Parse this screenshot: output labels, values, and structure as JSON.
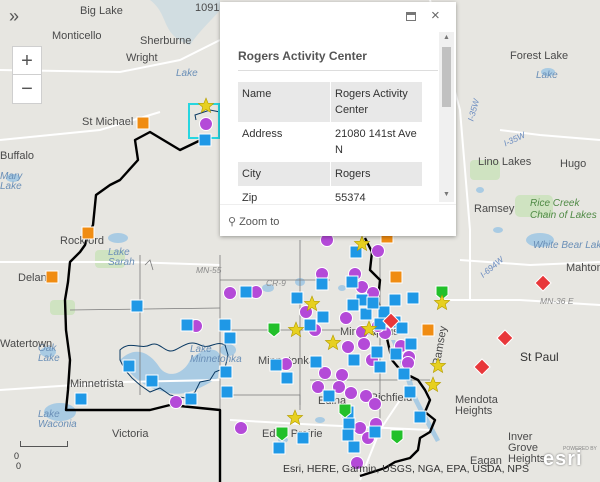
{
  "map": {
    "colors": {
      "background": "#e7e6e1",
      "water": "#a9cbe3",
      "park": "#cfe3c1",
      "boundary": "#000000",
      "blue_marker": "#1f98e6",
      "purple_marker": "#b44ad8",
      "orange_marker": "#f08c12",
      "red_marker": "#e8373a",
      "green_marker": "#22c02a",
      "yellow_marker": "#e7d020"
    },
    "place_labels": [
      {
        "text": "Big Lake",
        "style": "lg"
      },
      {
        "text": "Monticello",
        "style": "lg"
      },
      {
        "text": "Sherburne",
        "style": "lg"
      },
      {
        "text": "Wright",
        "style": "lg"
      },
      {
        "text": "St Michael",
        "style": "lg"
      },
      {
        "text": "Buffalo",
        "style": "lg"
      },
      {
        "text": "Mary Lake",
        "style": "water"
      },
      {
        "text": "Rockford",
        "style": "lg"
      },
      {
        "text": "Delano",
        "style": "lg"
      },
      {
        "text": "Lake Sarah",
        "style": "water"
      },
      {
        "text": "Oak Lake",
        "style": "water"
      },
      {
        "text": "Watertown",
        "style": "lg"
      },
      {
        "text": "Minnetrista",
        "style": "lg"
      },
      {
        "text": "Lake Waconia",
        "style": "water"
      },
      {
        "text": "Victoria",
        "style": "lg"
      },
      {
        "text": "Lake Minnetonka",
        "style": "water"
      },
      {
        "text": "Minnetonka",
        "style": "lg"
      },
      {
        "text": "Edina",
        "style": "lg"
      },
      {
        "text": "Eden Prairie",
        "style": "lg"
      },
      {
        "text": "Richfield",
        "style": "lg"
      },
      {
        "text": "Minneapolis",
        "style": "lg"
      },
      {
        "text": "Ramsey",
        "style": "lg"
      },
      {
        "text": "Forest Lake",
        "style": "lg"
      },
      {
        "text": "Lino Lakes",
        "style": "lg"
      },
      {
        "text": "Hugo",
        "style": "lg"
      },
      {
        "text": "Rice Creek",
        "style": "green"
      },
      {
        "text": "Chain of Lakes",
        "style": "green"
      },
      {
        "text": "White Bear Lake",
        "style": "water"
      },
      {
        "text": "Mahtomedi",
        "style": "lg"
      },
      {
        "text": "St Paul",
        "style": "city"
      },
      {
        "text": "Mendota Heights",
        "style": "lg"
      },
      {
        "text": "Inver Grove Heights",
        "style": "lg"
      },
      {
        "text": "Eagan",
        "style": "lg"
      },
      {
        "text": "1091 ft",
        "style": "lg"
      },
      {
        "text": "Lake",
        "style": "water"
      },
      {
        "text": "I-35W",
        "style": "road-blue"
      },
      {
        "text": "I-35W",
        "style": "road-blue"
      },
      {
        "text": "I-694W",
        "style": "road-blue"
      },
      {
        "text": "MN-36 E",
        "style": "road"
      },
      {
        "text": "CR-9",
        "style": "road"
      },
      {
        "text": "MN-55",
        "style": "road"
      },
      {
        "text": "Ramsey",
        "style": "lg"
      },
      {
        "text": "Lake",
        "style": "water"
      }
    ]
  },
  "controls": {
    "expand_label": "»",
    "zoom_in_label": "+",
    "zoom_out_label": "−"
  },
  "popup": {
    "title": "Rogers Activity Center",
    "close_label": "×",
    "fields": [
      {
        "name": "Name",
        "value": "Rogers Activity Center"
      },
      {
        "name": "Address",
        "value": "21080 141st Ave N"
      },
      {
        "name": "City",
        "value": "Rogers"
      },
      {
        "name": "Zip",
        "value": "55374"
      }
    ],
    "zoom_to_label": "Zoom to"
  },
  "attribution": "Esri, HERE, Garmin, USGS, NGA, EPA, USDA, NPS",
  "scale": {
    "label_top": "0",
    "label_bottom": "0"
  },
  "logo": {
    "text": "esri",
    "powered_by": "POWERED BY"
  }
}
